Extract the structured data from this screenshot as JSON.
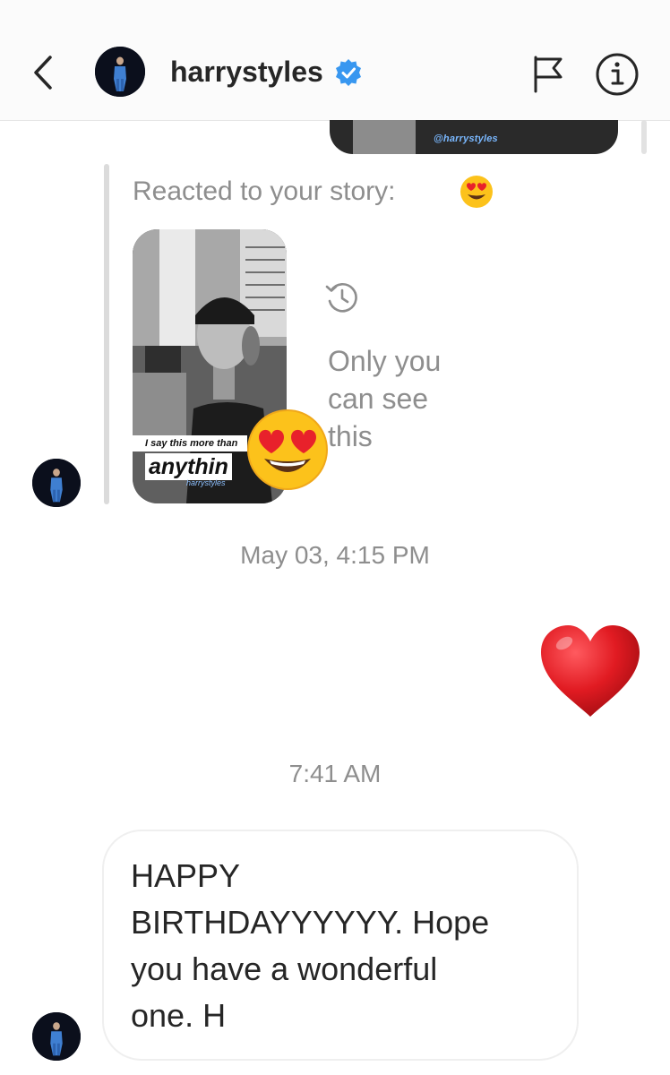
{
  "header": {
    "username": "harrystyles",
    "verified": true
  },
  "previous_story": {
    "tag": "@harrystyles"
  },
  "reply": {
    "reacted_text": "Reacted to your story:",
    "reaction_emoji": "heart-eyes-emoji",
    "story_caption_small": "I say this more than",
    "story_caption_big": "anythin",
    "story_tag": "harrystyles",
    "only_you_line1": "Only you",
    "only_you_line2": "can see",
    "only_you_line3": "this"
  },
  "timestamps": {
    "first": "May 03, 4:15 PM",
    "second": "7:41 AM"
  },
  "sent_message": {
    "type": "heart-icon",
    "color": "#ed1f29"
  },
  "message": {
    "line1": "HAPPY",
    "line2": "BIRTHDAYYYYYY. Hope",
    "line3": "you have a wonderful",
    "line4": "one. H"
  },
  "colors": {
    "verified_badge": "#3897f0",
    "secondary_text": "#8e8e8e"
  }
}
